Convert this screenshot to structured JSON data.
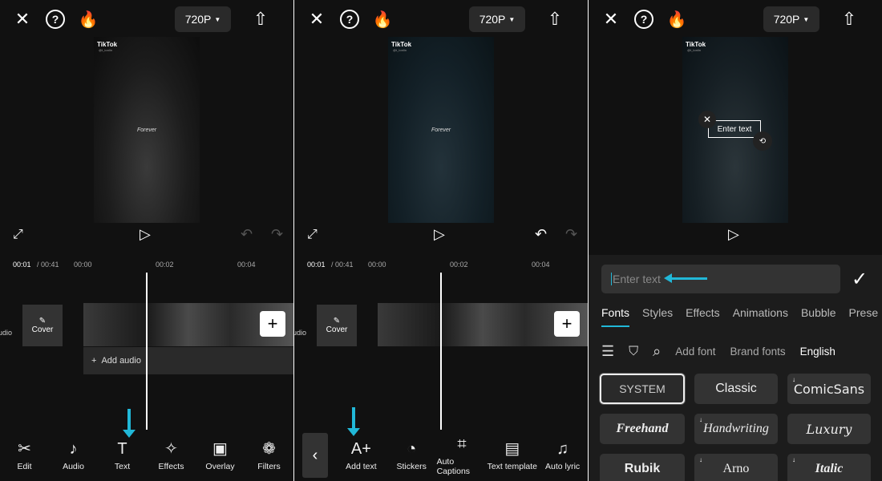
{
  "topbar": {
    "resolution": "720P"
  },
  "preview": {
    "brand": "TikTok",
    "username": "@t_tonlin",
    "lyric": "Forever"
  },
  "timeline": {
    "current": "00:01",
    "total": "/ 00:41",
    "ticks": [
      "00:00",
      "00:02",
      "00:04"
    ],
    "cover_label": "Cover",
    "audio_label": "udio",
    "add_audio": "Add audio"
  },
  "toolbar1": [
    {
      "label": "Edit",
      "glyph": "✂"
    },
    {
      "label": "Audio",
      "glyph": "♪"
    },
    {
      "label": "Text",
      "glyph": "T"
    },
    {
      "label": "Effects",
      "glyph": "✧"
    },
    {
      "label": "Overlay",
      "glyph": "▣"
    },
    {
      "label": "Filters",
      "glyph": "❁"
    }
  ],
  "toolbar2": [
    {
      "label": "Add text",
      "glyph": "A+"
    },
    {
      "label": "Stickers",
      "glyph": "◔"
    },
    {
      "label": "Auto Captions",
      "glyph": "⌗"
    },
    {
      "label": "Text template",
      "glyph": "▤"
    },
    {
      "label": "Auto lyric",
      "glyph": "♫"
    }
  ],
  "text_editor": {
    "placeholder": "Enter text",
    "overlay_text": "Enter text",
    "tabs": [
      "Fonts",
      "Styles",
      "Effects",
      "Animations",
      "Bubble",
      "Prese"
    ],
    "font_tools": {
      "add_font": "Add font",
      "brand_fonts": "Brand fonts",
      "language": "English"
    },
    "fonts": [
      "SYSTEM",
      "Classic",
      "ComicSans",
      "Freehand",
      "Handwriting",
      "Luxury",
      "Rubik",
      "Arno",
      "Italic"
    ]
  },
  "colors": {
    "accent": "#21b8d8",
    "background": "#111111",
    "panel": "#1c1c1c"
  }
}
